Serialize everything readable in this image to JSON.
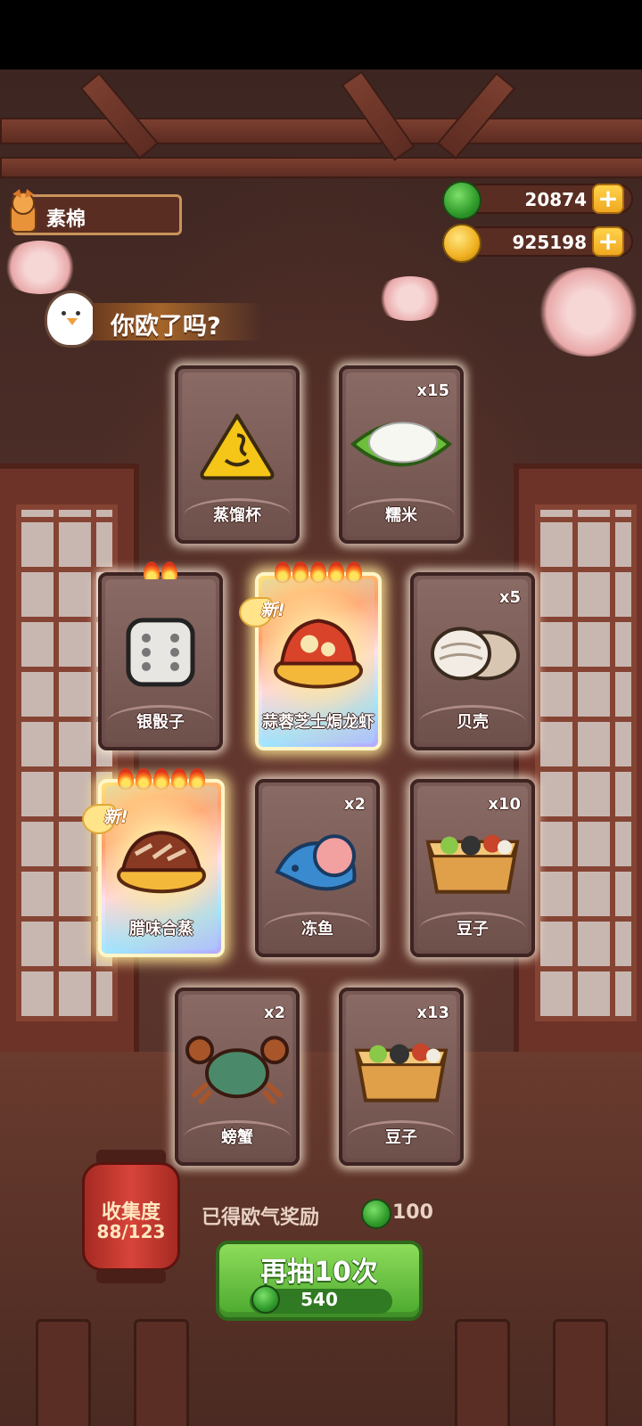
{
  "player": {
    "name": "素棉"
  },
  "currencies": [
    {
      "id": "jade",
      "value": "20874",
      "icon": "green-jade-icon"
    },
    {
      "id": "coin",
      "value": "925198",
      "icon": "gold-coin-icon"
    }
  ],
  "banner": {
    "text": "你欧了吗?"
  },
  "new_tag": "新!",
  "cards": [
    {
      "name": "蒸馏杯",
      "qty": "",
      "icon": "steamer-cup-icon"
    },
    {
      "name": "糯米",
      "qty": "x15",
      "icon": "sticky-rice-icon"
    },
    {
      "name": "银骰子",
      "qty": "",
      "icon": "silver-dice-icon",
      "stars": 2
    },
    {
      "name": "蒜蓉芝士焗龙虾",
      "qty": "",
      "icon": "cheese-lobster-icon",
      "stars": 5,
      "new": true
    },
    {
      "name": "贝壳",
      "qty": "x5",
      "icon": "shell-icon"
    },
    {
      "name": "腊味合蒸",
      "qty": "",
      "icon": "cured-meat-dish-icon",
      "stars": 5,
      "new": true
    },
    {
      "name": "冻鱼",
      "qty": "x2",
      "icon": "frozen-fish-icon"
    },
    {
      "name": "豆子",
      "qty": "x10",
      "icon": "beans-box-icon"
    },
    {
      "name": "螃蟹",
      "qty": "x2",
      "icon": "crab-icon"
    },
    {
      "name": "豆子",
      "qty": "x13",
      "icon": "beans-box-icon"
    }
  ],
  "collection": {
    "label": "收集度",
    "value": "88/123"
  },
  "reward": {
    "label": "已得欧气奖励",
    "value": "100"
  },
  "draw_button": {
    "label": "再抽10次",
    "cost": "540"
  },
  "colors": {
    "accent_green": "#4aa82e",
    "gold": "#ffd34a",
    "lantern_red": "#d8443a"
  }
}
